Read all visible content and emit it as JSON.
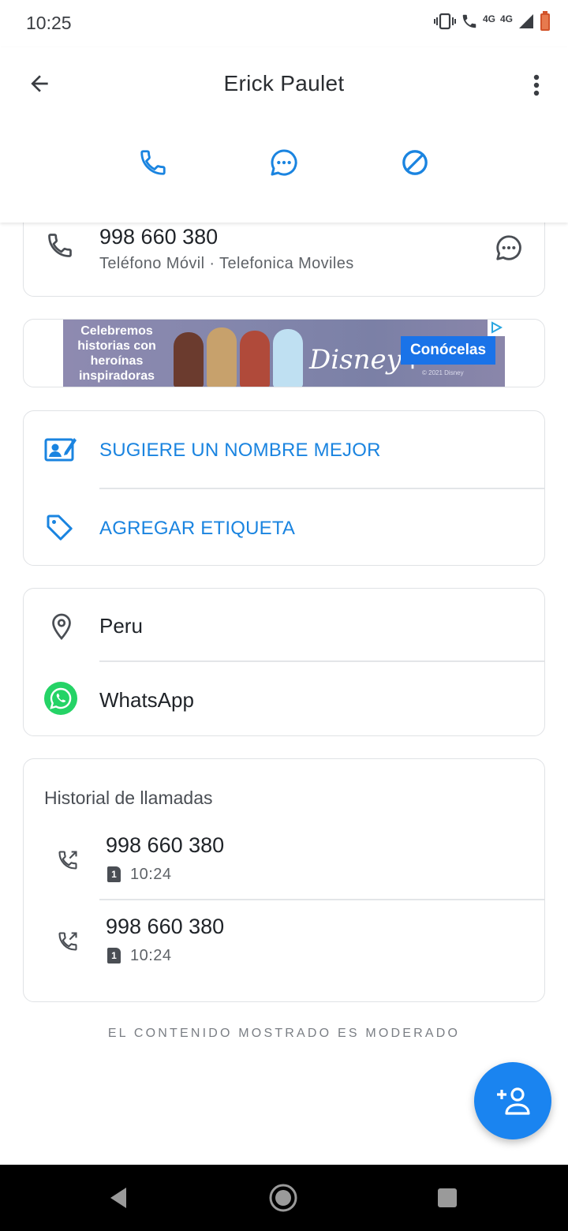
{
  "status_bar": {
    "time": "10:25",
    "net_1": "4G",
    "net_2": "4G",
    "icons": [
      "vibrate-icon",
      "wifi-call-icon",
      "signal-icon",
      "battery-icon"
    ]
  },
  "header": {
    "contact_name": "Erick Paulet",
    "back_icon": "arrow-left-icon",
    "more_icon": "more-vert-icon",
    "actions": [
      {
        "name": "call",
        "icon": "phone-icon"
      },
      {
        "name": "message",
        "icon": "message-icon"
      },
      {
        "name": "block",
        "icon": "block-icon"
      }
    ]
  },
  "phone_card": {
    "number": "998 660 380",
    "subtitle": "Teléfono Móvil · Telefonica Moviles"
  },
  "ad": {
    "headline": "Celebremos historias con heroínas inspiradoras",
    "brand": "Disney+",
    "cta": "Conócelas",
    "copyright": "© 2021 Disney"
  },
  "suggest_card": {
    "suggest_label": "SUGIERE UN NOMBRE MEJOR",
    "tag_label": "AGREGAR ETIQUETA"
  },
  "info_card": {
    "location": "Peru",
    "messenger": "WhatsApp"
  },
  "history": {
    "title": "Historial de llamadas",
    "calls": [
      {
        "number": "998 660 380",
        "sim": "1",
        "time": "10:24"
      },
      {
        "number": "998 660 380",
        "sim": "1",
        "time": "10:24"
      }
    ]
  },
  "footer_note": "EL CONTENIDO MOSTRADO ES MODERADO",
  "colors": {
    "accent": "#1a84e0",
    "fab": "#1a84f0",
    "whatsapp": "#25d366",
    "ad_cta": "#1a73e8"
  }
}
